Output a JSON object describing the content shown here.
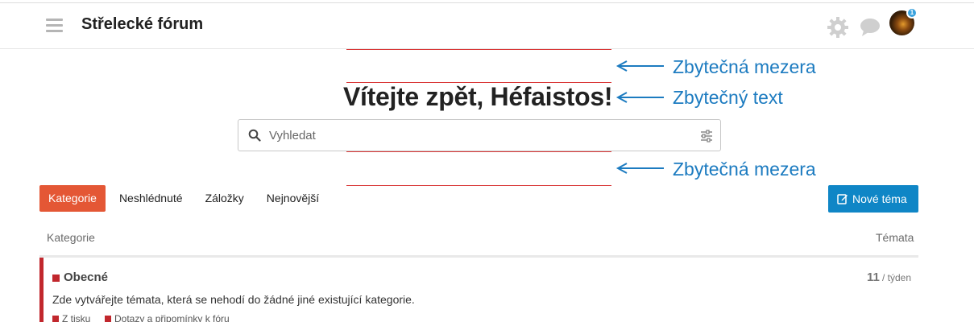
{
  "header": {
    "site_title": "Střelecké fórum",
    "notification_count": "1"
  },
  "annotations": {
    "gap_top": "Zbytečná mezera",
    "text": "Zbytečný text",
    "gap_bottom": "Zbytečná mezera"
  },
  "welcome": {
    "title": "Vítejte zpět, Héfaistos!"
  },
  "search": {
    "placeholder": "Vyhledat"
  },
  "nav": {
    "tabs": [
      "Kategorie",
      "Neshlédnuté",
      "Záložky",
      "Nejnovější"
    ],
    "new_topic_label": "Nové téma"
  },
  "table": {
    "col_category": "Kategorie",
    "col_topics": "Témata"
  },
  "category": {
    "name": "Obecné",
    "count": "11",
    "period": " / týden",
    "description": "Zde vytvářejte témata, která se nehodí do žádné jiné existující kategorie.",
    "subcategories": [
      "Z tisku",
      "Dotazy a připomínky k fóru"
    ]
  },
  "colors": {
    "accent": "#e45735",
    "primary_button": "#0f86c6",
    "category": "#c1272d",
    "annotation": "#1c7bc0",
    "guide_line": "#d93636"
  }
}
